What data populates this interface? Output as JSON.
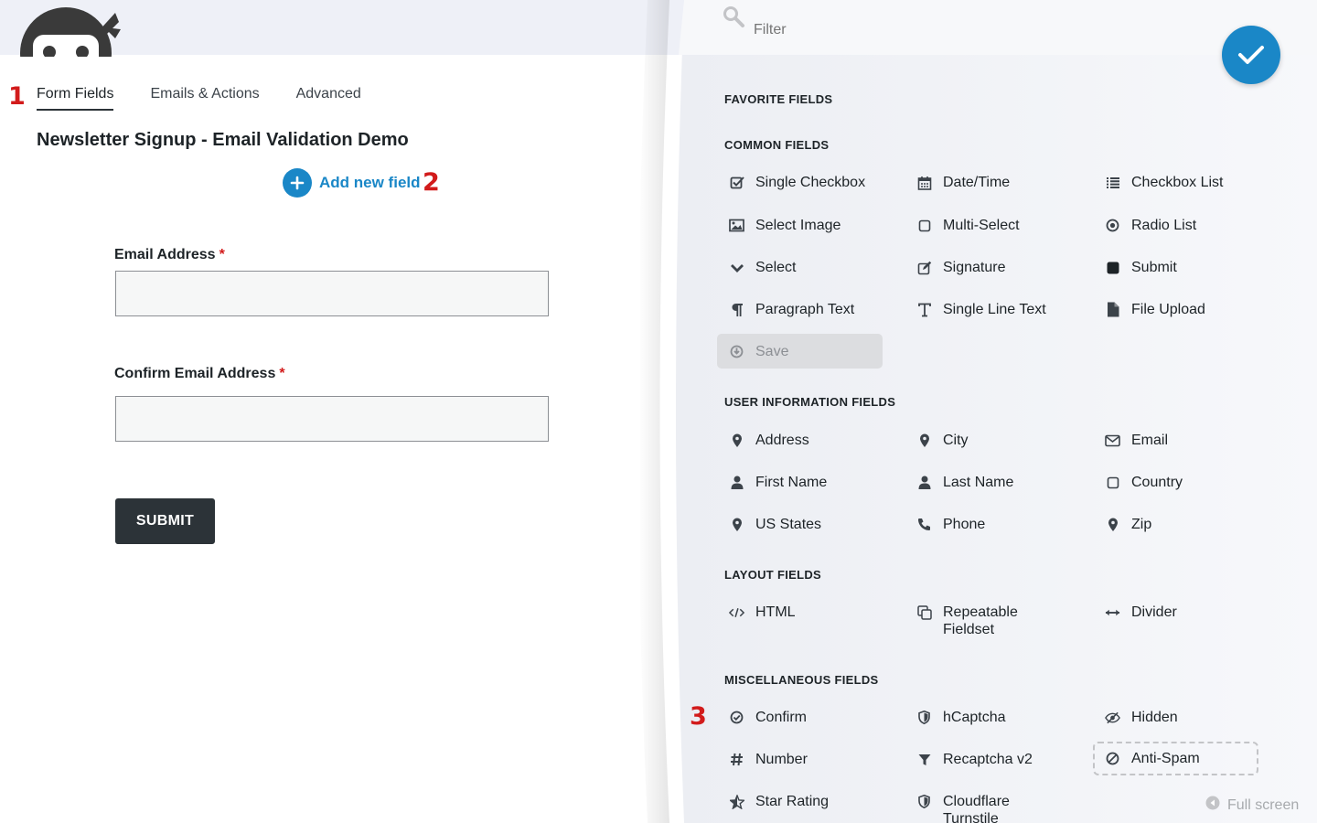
{
  "tabs": {
    "form_fields": "Form Fields",
    "emails_actions": "Emails & Actions",
    "advanced": "Advanced"
  },
  "annotations": {
    "one": "1",
    "two": "2",
    "three": "3"
  },
  "form": {
    "title": "Newsletter Signup - Email Validation Demo",
    "add_field_label": "Add new field",
    "fields": [
      {
        "label": "Email Address",
        "required_mark": "*"
      },
      {
        "label": "Confirm Email Address",
        "required_mark": "*"
      }
    ],
    "submit_label": "SUBMIT"
  },
  "drawer": {
    "filter_placeholder": "Filter",
    "sections": {
      "favorite": "FAVORITE FIELDS",
      "common": "COMMON FIELDS",
      "user_info": "USER INFORMATION FIELDS",
      "layout": "LAYOUT FIELDS",
      "misc": "MISCELLANEOUS FIELDS"
    },
    "common_fields": [
      {
        "label": "Single Checkbox",
        "icon": "checkbox-checked-icon"
      },
      {
        "label": "Date/Time",
        "icon": "calendar-icon"
      },
      {
        "label": "Checkbox List",
        "icon": "list-icon"
      },
      {
        "label": "Select Image",
        "icon": "image-icon"
      },
      {
        "label": "Multi-Select",
        "icon": "square-outline-icon"
      },
      {
        "label": "Radio List",
        "icon": "radio-icon"
      },
      {
        "label": "Select",
        "icon": "chevron-down-icon"
      },
      {
        "label": "Signature",
        "icon": "pencil-square-icon"
      },
      {
        "label": "Submit",
        "icon": "square-filled-icon"
      },
      {
        "label": "Paragraph Text",
        "icon": "paragraph-icon"
      },
      {
        "label": "Single Line Text",
        "icon": "text-cursor-icon"
      },
      {
        "label": "File Upload",
        "icon": "file-icon"
      },
      {
        "label": "Save",
        "icon": "save-icon"
      }
    ],
    "user_fields": [
      {
        "label": "Address",
        "icon": "map-pin-icon"
      },
      {
        "label": "City",
        "icon": "map-pin-icon"
      },
      {
        "label": "Email",
        "icon": "envelope-icon"
      },
      {
        "label": "First Name",
        "icon": "user-icon"
      },
      {
        "label": "Last Name",
        "icon": "user-icon"
      },
      {
        "label": "Country",
        "icon": "square-outline-icon"
      },
      {
        "label": "US States",
        "icon": "map-pin-icon"
      },
      {
        "label": "Phone",
        "icon": "phone-icon"
      },
      {
        "label": "Zip",
        "icon": "map-pin-icon"
      }
    ],
    "layout_fields": [
      {
        "label": "HTML",
        "icon": "code-icon"
      },
      {
        "label": "Repeatable Fieldset",
        "icon": "copy-icon"
      },
      {
        "label": "Divider",
        "icon": "arrows-horizontal-icon"
      }
    ],
    "misc_fields": [
      {
        "label": "Confirm",
        "icon": "check-circle-icon"
      },
      {
        "label": "hCaptcha",
        "icon": "shield-icon"
      },
      {
        "label": "Hidden",
        "icon": "eye-slash-icon"
      },
      {
        "label": "Number",
        "icon": "hash-icon"
      },
      {
        "label": "Recaptcha v2",
        "icon": "filter-icon"
      },
      {
        "label": "Anti-Spam",
        "icon": "ban-icon"
      },
      {
        "label": "Star Rating",
        "icon": "star-half-icon"
      },
      {
        "label": "Cloudflare Turnstile",
        "icon": "shield-icon"
      }
    ],
    "fullscreen_label": "Full screen",
    "accent_color": "#1a87c7"
  }
}
